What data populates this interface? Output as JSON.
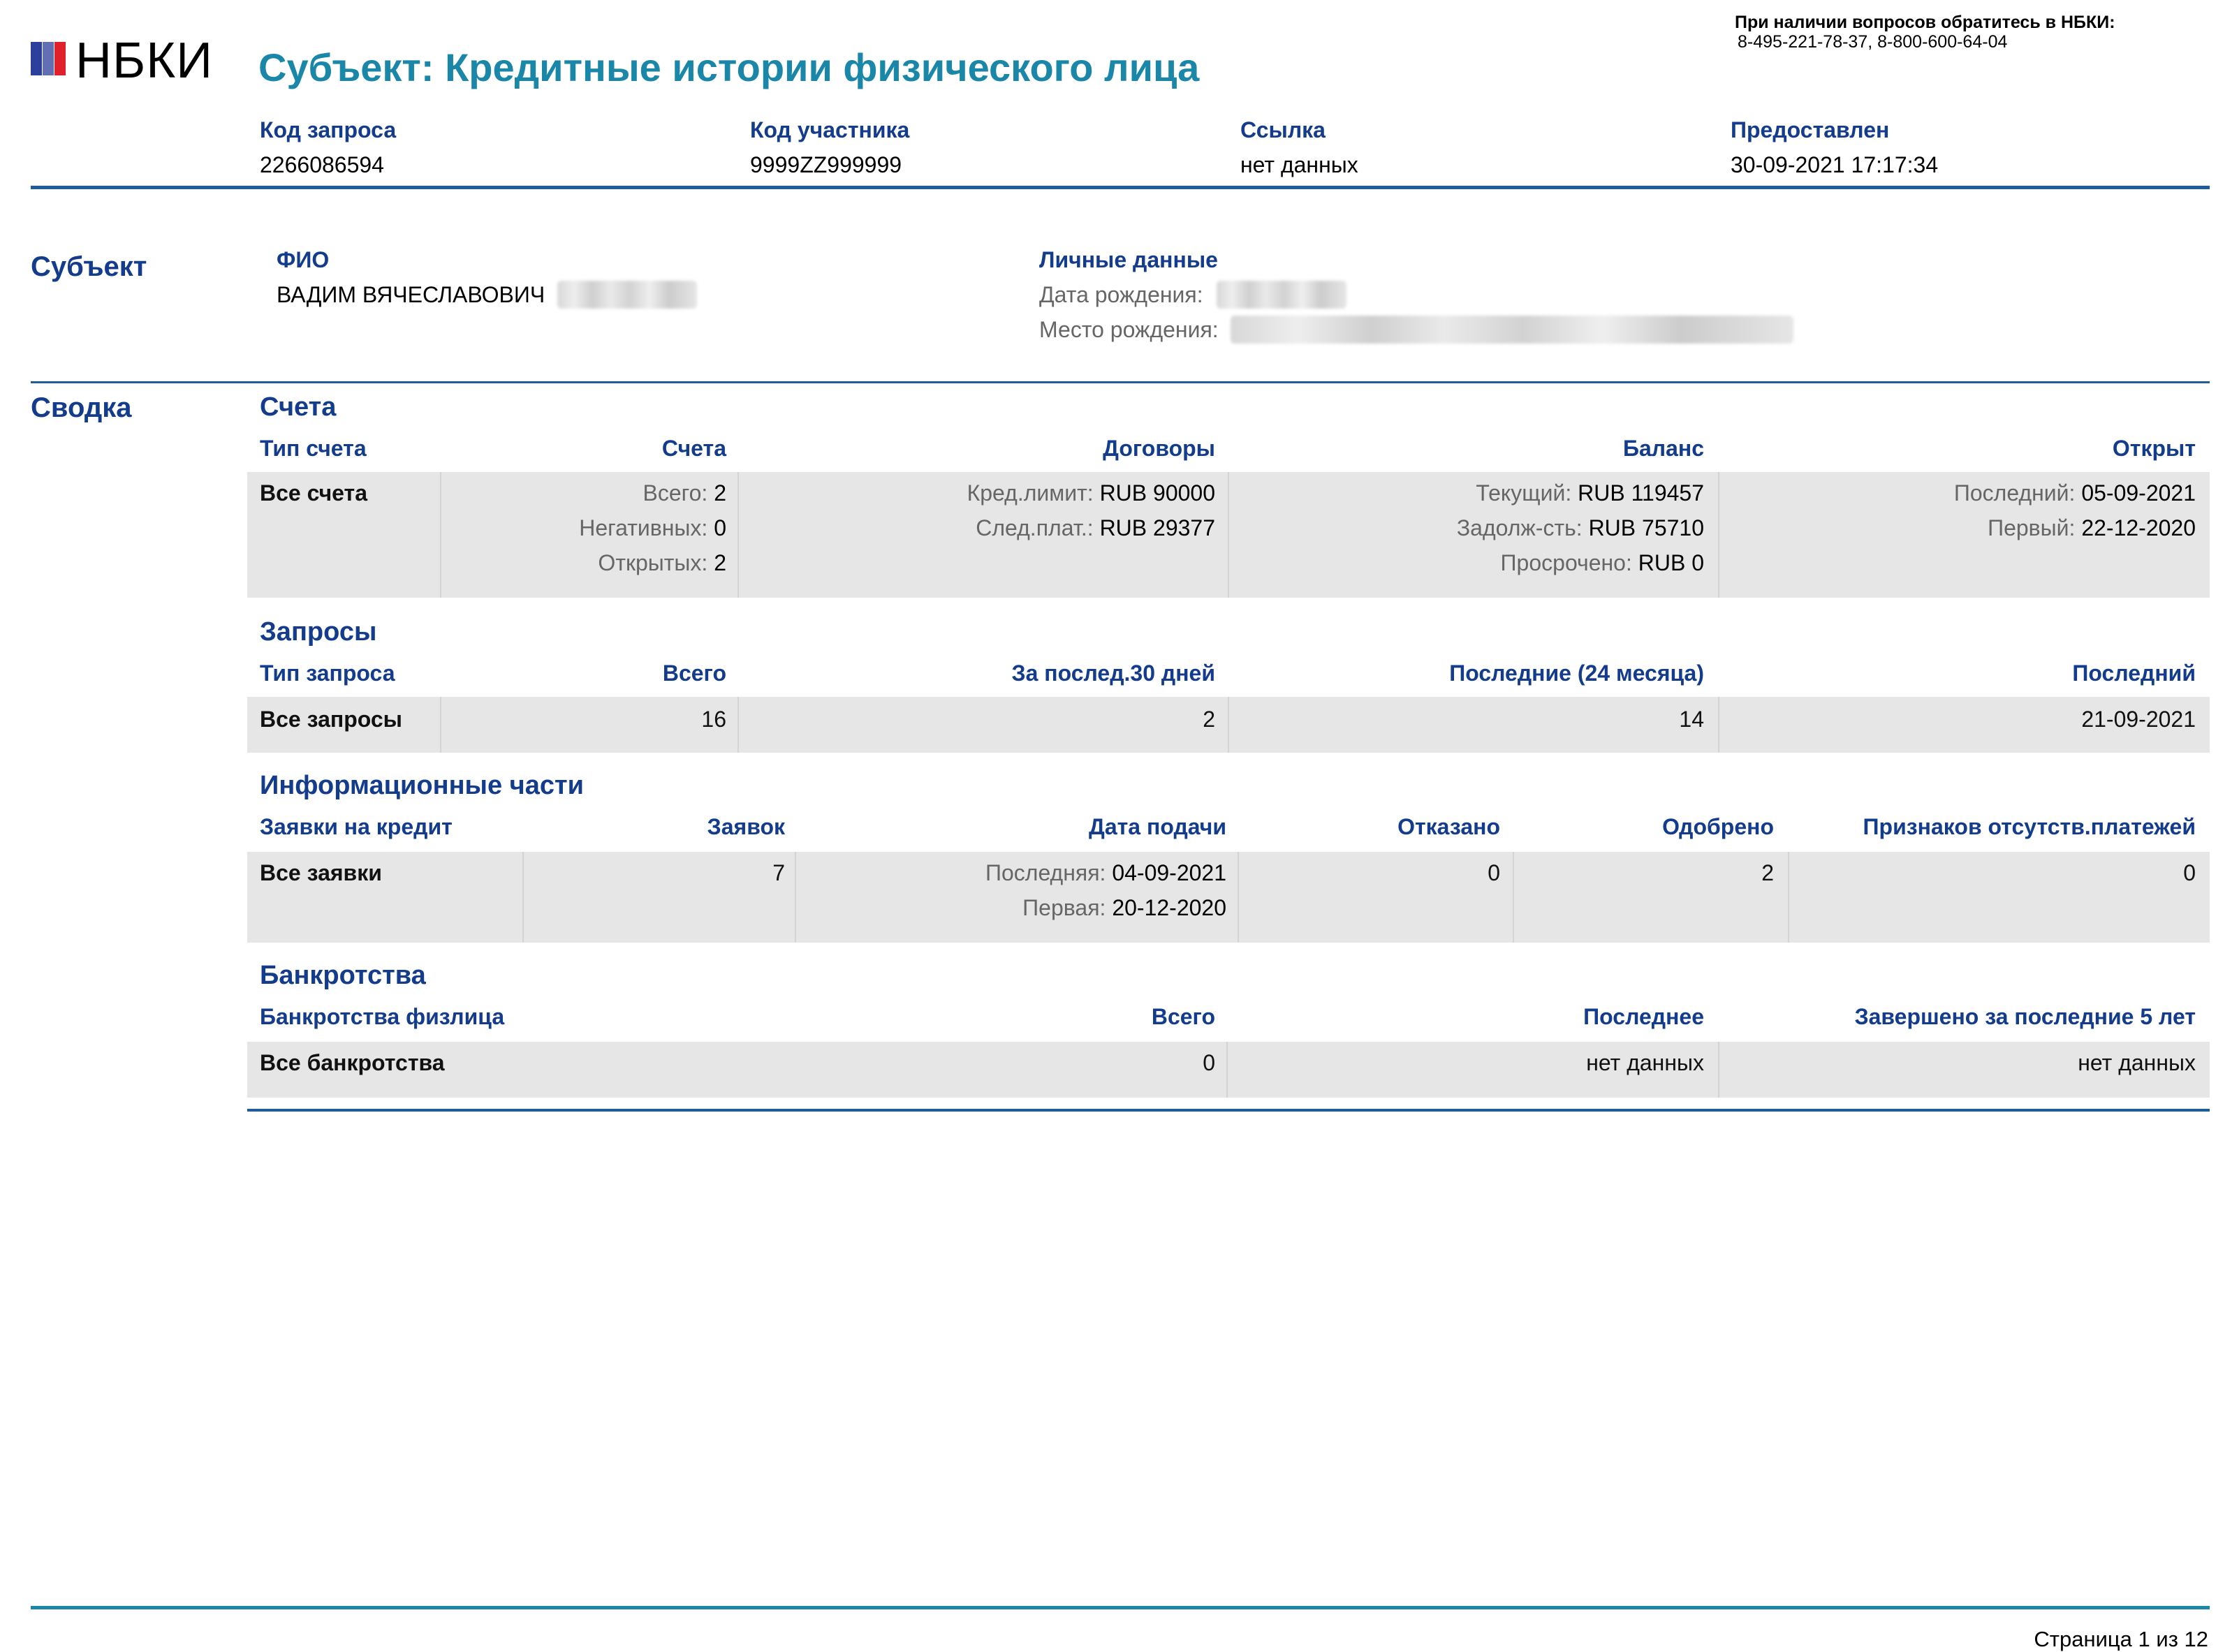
{
  "header": {
    "logo_text": "НБКИ",
    "logo_colors": [
      "#2d3f9c",
      "#2d3f9c",
      "#e0202a"
    ],
    "title": "Субъект: Кредитные истории физического лица",
    "contact_line1": "При наличии вопросов обратитесь в НБКИ:",
    "contact_line2": "8-495-221-78-37, 8-800-600-64-04"
  },
  "meta": [
    {
      "label": "Код запроса",
      "value": "2266086594"
    },
    {
      "label": "Код участника",
      "value": "9999ZZ999999"
    },
    {
      "label": "Ссылка",
      "value": "нет данных"
    },
    {
      "label": "Предоставлен",
      "value": "30-09-2021 17:17:34"
    }
  ],
  "subject": {
    "section_title": "Субъект",
    "fio_label": "ФИО",
    "fio_value": "ВАДИМ ВЯЧЕСЛАВОВИЧ",
    "personal_label": "Личные данные",
    "birth_date_label": "Дата рождения:",
    "birth_place_label": "Место рождения:"
  },
  "summary": {
    "section_title": "Сводка",
    "accounts": {
      "title": "Счета",
      "headers": [
        "Тип счета",
        "Счета",
        "Договоры",
        "Баланс",
        "Открыт"
      ],
      "row_label": "Все счета",
      "counts": [
        {
          "label": "Всего:",
          "value": "2"
        },
        {
          "label": "Негативных:",
          "value": "0"
        },
        {
          "label": "Открытых:",
          "value": "2"
        }
      ],
      "contracts": [
        {
          "label": "Кред.лимит:",
          "value": "RUB 90000"
        },
        {
          "label": "След.плат.:",
          "value": "RUB 29377"
        }
      ],
      "balance": [
        {
          "label": "Текущий:",
          "value": "RUB 119457"
        },
        {
          "label": "Задолж-сть:",
          "value": "RUB 75710"
        },
        {
          "label": "Просрочено:",
          "value": "RUB 0"
        }
      ],
      "opened": [
        {
          "label": "Последний:",
          "value": "05-09-2021"
        },
        {
          "label": "Первый:",
          "value": "22-12-2020"
        }
      ]
    },
    "inquiries": {
      "title": "Запросы",
      "headers": [
        "Тип запроса",
        "Всего",
        "За послед.30 дней",
        "Последние (24 месяца)",
        "Последний"
      ],
      "row": [
        "Все запросы",
        "16",
        "2",
        "14",
        "21-09-2021"
      ]
    },
    "info_parts": {
      "title": "Информационные части",
      "headers": [
        "Заявки на кредит",
        "Заявок",
        "Дата подачи",
        "Отказано",
        "Одобрено",
        "Признаков отсутств.платежей"
      ],
      "row_label": "Все заявки",
      "applications": "7",
      "dates": [
        {
          "label": "Последняя:",
          "value": "04-09-2021"
        },
        {
          "label": "Первая:",
          "value": "20-12-2020"
        }
      ],
      "rejected": "0",
      "approved": "2",
      "no_payment_signs": "0"
    },
    "bankruptcy": {
      "title": "Банкротства",
      "headers": [
        "Банкротства физлица",
        "Всего",
        "Последнее",
        "Завершено за последние 5 лет"
      ],
      "row": [
        "Все банкротства",
        "0",
        "нет данных",
        "нет данных"
      ]
    }
  },
  "footer": {
    "page": "Страница 1 из 12"
  }
}
